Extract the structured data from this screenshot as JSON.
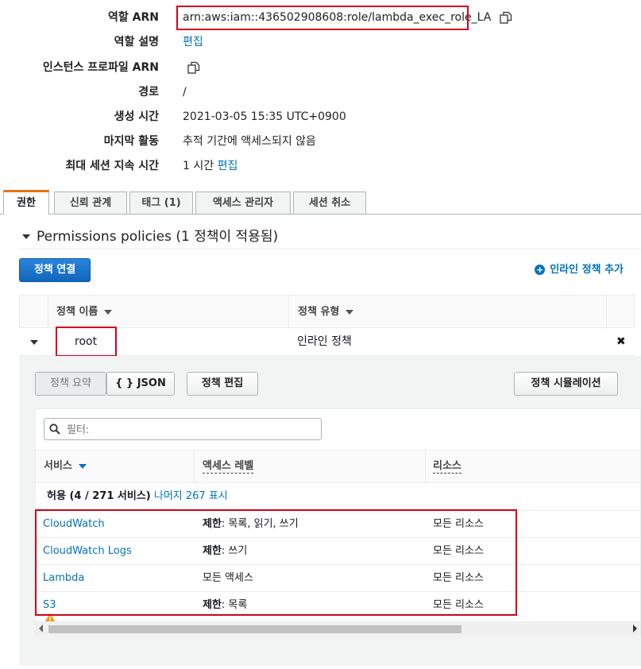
{
  "summary": [
    {
      "label": "역할 ARN",
      "value": "arn:aws:iam::436502908608:role/lambda_exec_role_LA",
      "copy": true
    },
    {
      "label": "역할 설명",
      "value": "편집",
      "link": true
    },
    {
      "label": "인스턴스 프로파일 ARN",
      "value": "",
      "copy": true
    },
    {
      "label": "경로",
      "value": "/"
    },
    {
      "label": "생성 시간",
      "value": "2021-03-05 15:35 UTC+0900"
    },
    {
      "label": "마지막 활동",
      "value": "추적 기간에 액세스되지 않음"
    },
    {
      "label": "최대 세션 지속 시간",
      "value": "1 시간",
      "link_text": "편집"
    }
  ],
  "tabs": [
    "권한",
    "신뢰 관계",
    "태그 (1)",
    "액세스 관리자",
    "세션 취소"
  ],
  "permissions": {
    "section_title": "Permissions policies (1 정책이 적용됨)",
    "attach_button": "정책 연결",
    "add_inline": "인라인 정책 추가",
    "columns": [
      "정책 이름",
      "정책 유형"
    ],
    "policy": {
      "name": "root",
      "type": "인라인 정책",
      "remove_icon": "✖"
    }
  },
  "detail": {
    "summary_button": "정책 요약",
    "json_button": "{ } JSON",
    "edit_button": "정책 편집",
    "simulate_button": "정책 시뮬레이션",
    "filter_placeholder": "필터:",
    "columns": [
      "서비스",
      "액세스 레벨",
      "리소스"
    ],
    "allow_prefix": "허용 (4 / 271 서비스)",
    "allow_link": "나머지 267 표시",
    "services": [
      {
        "name": "CloudWatch",
        "access_bold": "제한",
        "access_rest": ": 목록, 읽기, 쓰기",
        "resource": "모든 리소스"
      },
      {
        "name": "CloudWatch Logs",
        "access_bold": "제한",
        "access_rest": ": 쓰기",
        "resource": "모든 리소스"
      },
      {
        "name": "Lambda",
        "access_bold": "",
        "access_rest": "모든 액세스",
        "resource": "모든 리소스"
      },
      {
        "name": "S3",
        "access_bold": "제한",
        "access_rest": ": 목록",
        "resource": "모든 리소스"
      }
    ]
  },
  "colors": {
    "accent": "#0073bb",
    "highlight": "#d0021b",
    "tab_active": "#ec7211",
    "primary_button": "#1a6ec2",
    "warning": "#ff9900"
  },
  "icons": [
    "copy-icon",
    "caret-down-icon",
    "plus-circle-icon",
    "close-icon",
    "search-icon",
    "warning-icon"
  ]
}
